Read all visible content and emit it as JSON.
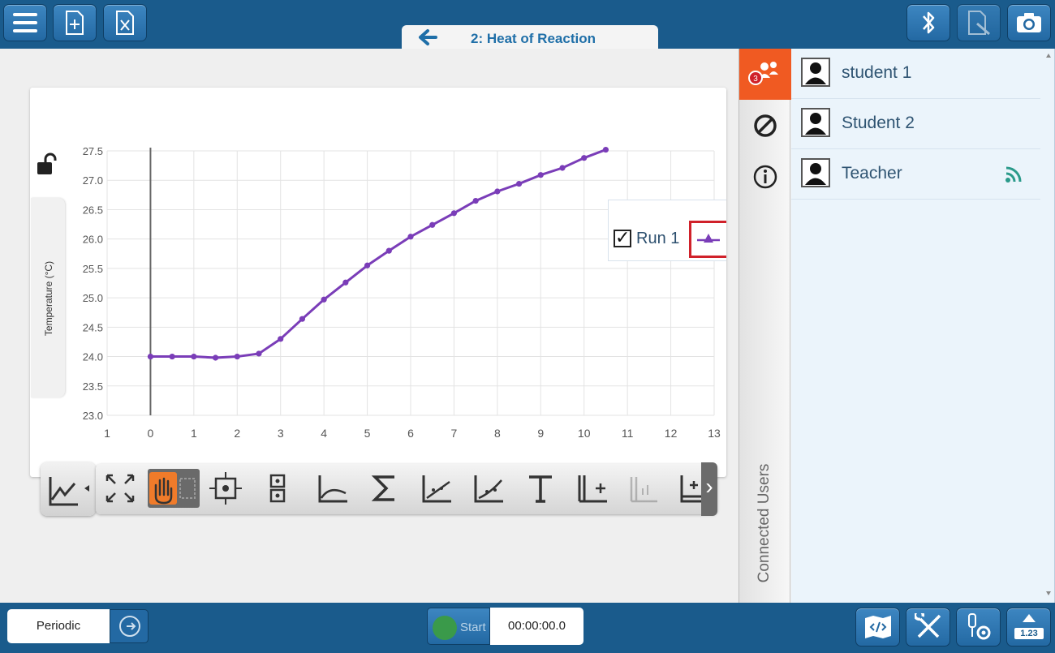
{
  "header": {
    "title": "2: Heat of Reaction"
  },
  "graph": {
    "y_axis_label": "Temperature (°C)",
    "legend": {
      "label": "Run 1",
      "checked": true
    }
  },
  "chart_data": {
    "type": "line",
    "title": "",
    "xlabel": "",
    "ylabel": "Temperature (°C)",
    "xlim": [
      -1,
      13
    ],
    "ylim": [
      23.0,
      27.5
    ],
    "x_ticks": [
      "1",
      "0",
      "1",
      "2",
      "3",
      "4",
      "5",
      "6",
      "7",
      "8",
      "9",
      "10",
      "11",
      "12",
      "13"
    ],
    "y_ticks": [
      "27.5",
      "27.0",
      "26.5",
      "26.0",
      "25.5",
      "25.0",
      "24.5",
      "24.0",
      "23.5",
      "23.0"
    ],
    "grid": true,
    "color": "#7a3db8",
    "series": [
      {
        "name": "Run 1",
        "x": [
          0,
          0.5,
          1,
          1.5,
          2,
          2.5,
          3,
          3.5,
          4,
          4.5,
          5,
          5.5,
          6,
          6.5,
          7,
          7.5,
          8,
          8.5,
          9,
          9.5,
          10,
          10.5
        ],
        "y": [
          24.0,
          24.0,
          24.0,
          23.98,
          24.0,
          24.05,
          24.3,
          24.64,
          24.97,
          25.26,
          25.55,
          25.8,
          26.04,
          26.24,
          26.44,
          26.65,
          26.81,
          26.94,
          27.09,
          27.21,
          27.38,
          27.52
        ]
      }
    ]
  },
  "toolbar": {
    "tools": [
      "graph-options",
      "autoscale",
      "pan-zoom",
      "examine",
      "crosshair",
      "tangent",
      "statistics",
      "linear-fit",
      "curve-fit",
      "annotation",
      "add-axis",
      "hidden-axis",
      "more"
    ]
  },
  "sidebar": {
    "tab_label": "Connected Users",
    "users": [
      "student 1",
      "Student 2",
      "Teacher"
    ]
  },
  "footer": {
    "mode": "Periodic",
    "start_label": "Start",
    "timer": "00:00:00.0",
    "meter_value": "1.23"
  }
}
